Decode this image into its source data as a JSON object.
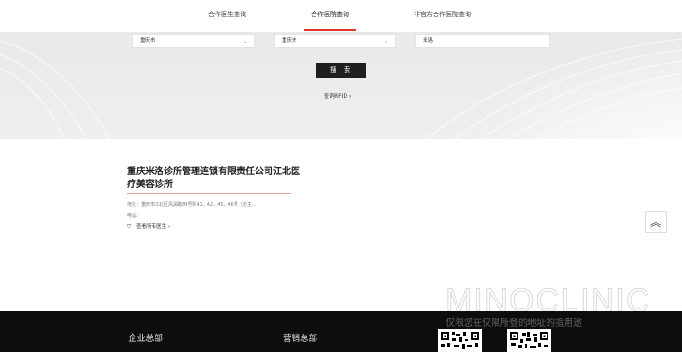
{
  "tabs": [
    {
      "label": "合作医生查询"
    },
    {
      "label": "合作医院查询"
    },
    {
      "label": "非官方合作医院查询"
    }
  ],
  "search": {
    "province": "重庆市",
    "city": "重庆市",
    "keyword": "米洛",
    "button_label": "搜 索",
    "rfid_link": "查询RFID ›"
  },
  "result": {
    "title": "重庆米洛诊所管理连锁有限责任公司江北医疗美容诊所",
    "address": "地址：重庆市江北区风澜路89号附41、42、45、46号（自主...",
    "phone": "电话：",
    "doctors_link": "查看所有医生 ›"
  },
  "watermark": {
    "brand": "MINOCLINIC",
    "caption": "仅限您在仅限所登的地址的指用途"
  },
  "footer": {
    "col1": "企业总部",
    "col2": "营销总部"
  },
  "colors": {
    "accent": "#d9382b",
    "footer_bg": "#0d0d0d",
    "search_button": "#1f1f1f"
  }
}
